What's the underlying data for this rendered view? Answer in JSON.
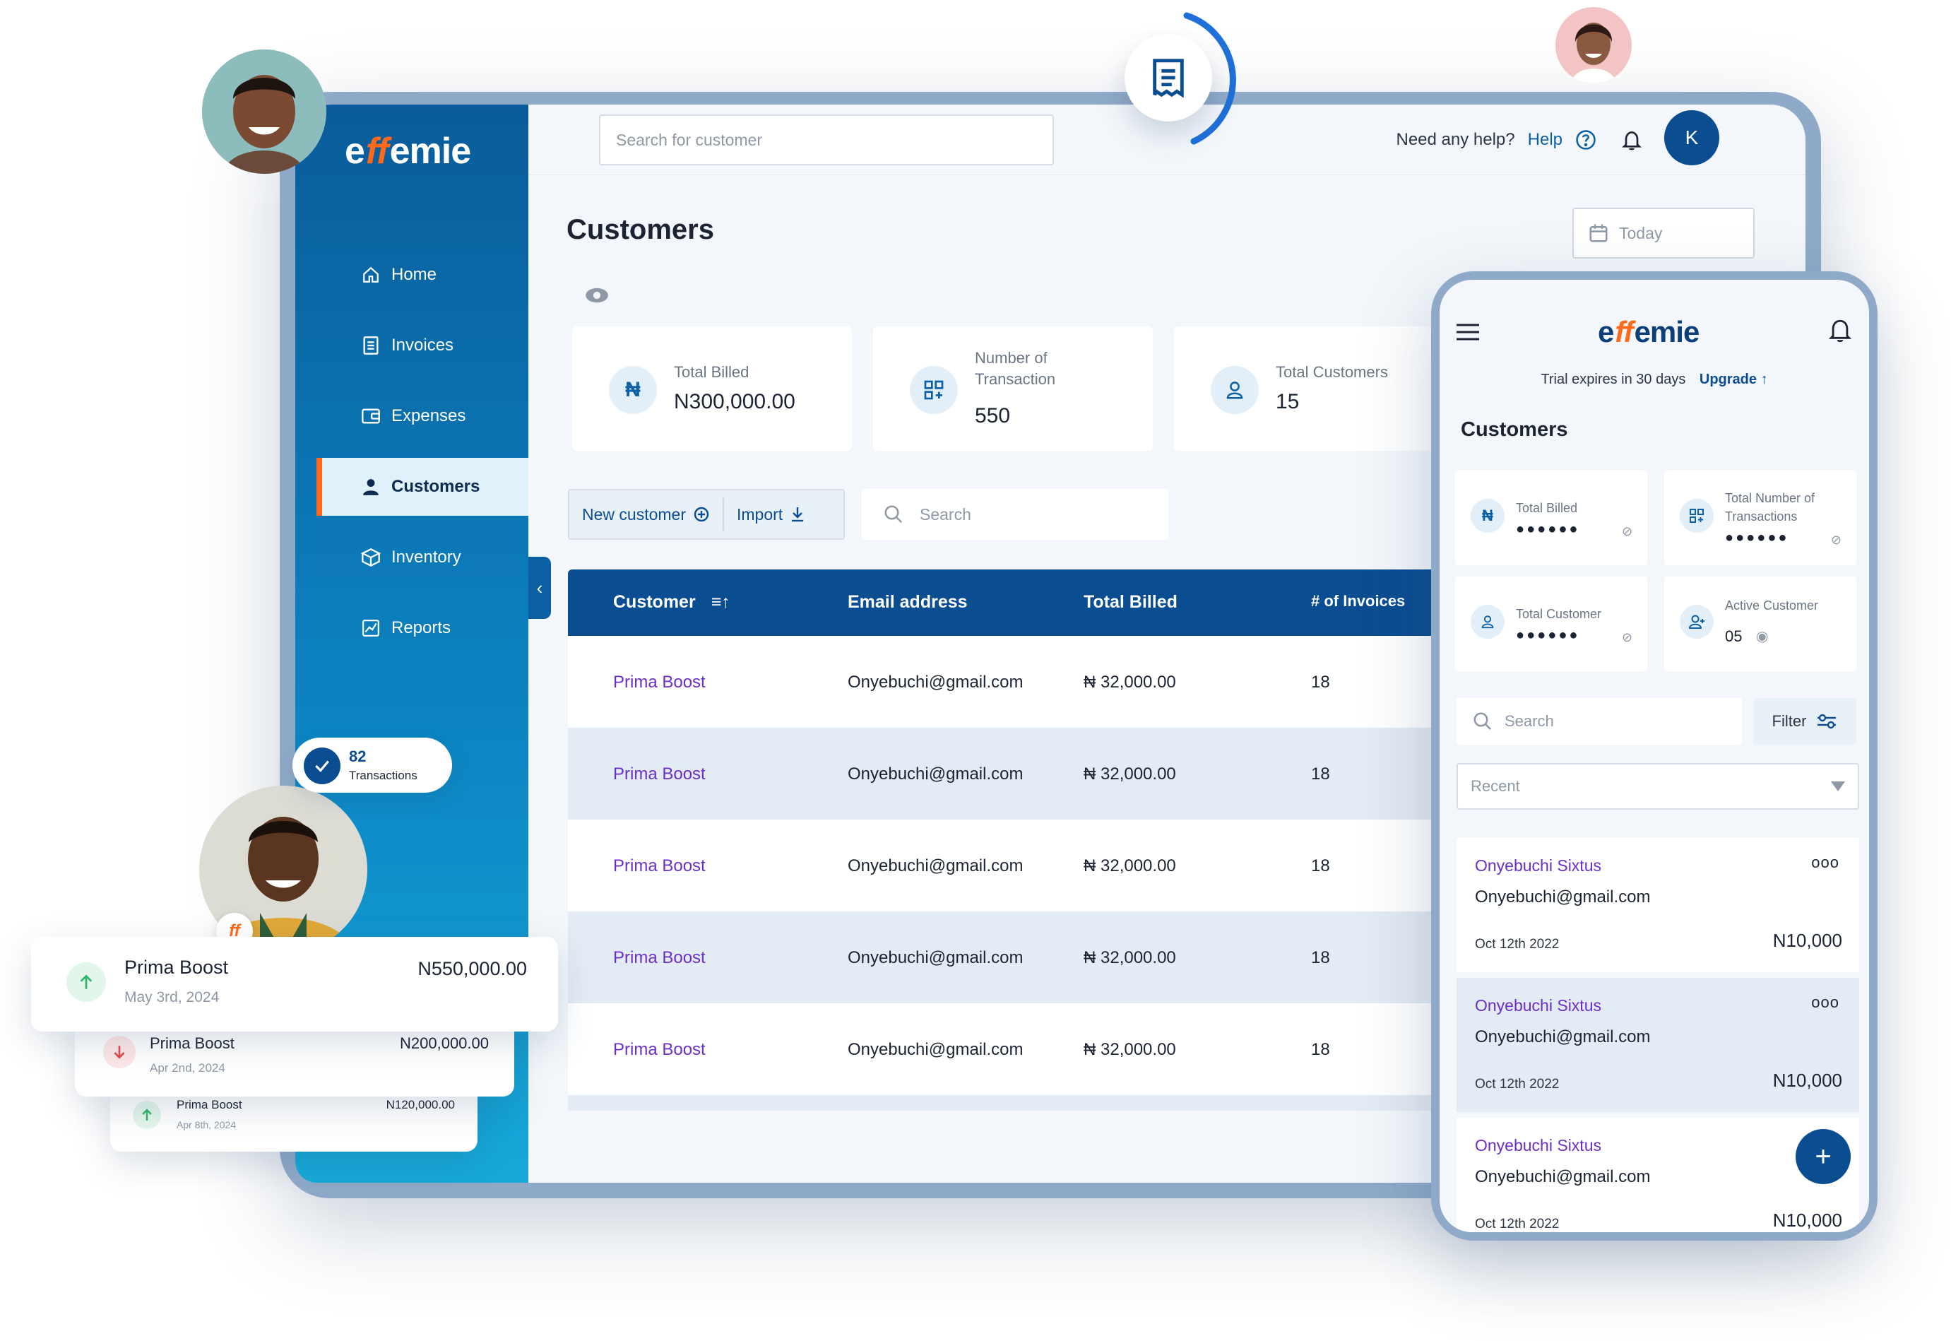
{
  "brand": {
    "logo_pre": "e",
    "logo_ff": "ff",
    "logo_post": "emie"
  },
  "sidebar": {
    "items": [
      {
        "label": "Home",
        "icon": "home-icon"
      },
      {
        "label": "Invoices",
        "icon": "invoice-icon"
      },
      {
        "label": "Expenses",
        "icon": "wallet-icon"
      },
      {
        "label": "Customers",
        "icon": "user-icon",
        "active": true
      },
      {
        "label": "Inventory",
        "icon": "box-icon"
      },
      {
        "label": "Reports",
        "icon": "chart-icon"
      }
    ]
  },
  "topbar": {
    "search_placeholder": "Search for customer",
    "help_prompt": "Need any help?",
    "help_link": "Help",
    "avatar_initial": "K"
  },
  "page": {
    "title": "Customers",
    "date_filter": "Today",
    "stats": [
      {
        "label": "Total Billed",
        "value": "N300,000.00",
        "icon_glyph": "₦"
      },
      {
        "label_line1": "Number of",
        "label_line2": "Transaction",
        "value": "550"
      },
      {
        "label": "Total Customers",
        "value": "15"
      }
    ],
    "actions": {
      "new_customer": "New customer",
      "import": "Import",
      "search_placeholder": "Search"
    }
  },
  "table": {
    "headers": {
      "customer": "Customer",
      "email": "Email address",
      "billed": "Total Billed",
      "invoices": "# of Invoices"
    },
    "rows": [
      {
        "name": "Prima Boost",
        "email": "Onyebuchi@gmail.com",
        "billed": "₦ 32,000.00",
        "invoices": "18"
      },
      {
        "name": "Prima Boost",
        "email": "Onyebuchi@gmail.com",
        "billed": "₦ 32,000.00",
        "invoices": "18"
      },
      {
        "name": "Prima Boost",
        "email": "Onyebuchi@gmail.com",
        "billed": "₦ 32,000.00",
        "invoices": "18"
      },
      {
        "name": "Prima Boost",
        "email": "Onyebuchi@gmail.com",
        "billed": "₦ 32,000.00",
        "invoices": "18"
      },
      {
        "name": "Prima Boost",
        "email": "Onyebuchi@gmail.com",
        "billed": "₦ 32,000.00",
        "invoices": "18"
      }
    ]
  },
  "mobile": {
    "trial_text": "Trial expires in 30 days",
    "upgrade": "Upgrade",
    "title": "Customers",
    "cards": [
      {
        "label": "Total Billed",
        "masked": "●●●●●●",
        "icon_glyph": "₦"
      },
      {
        "label_line1": "Total Number of",
        "label_line2": "Transactions",
        "masked": "●●●●●●"
      },
      {
        "label": "Total Customer",
        "masked": "●●●●●●"
      },
      {
        "label": "Active Customer",
        "value": "05"
      }
    ],
    "search_placeholder": "Search",
    "filter": "Filter",
    "sort_placeholder": "Recent",
    "items": [
      {
        "name": "Onyebuchi Sixtus",
        "email": "Onyebuchi@gmail.com",
        "date": "Oct 12th 2022",
        "amount": "N10,000",
        "more": "ooo"
      },
      {
        "name": "Onyebuchi Sixtus",
        "email": "Onyebuchi@gmail.com",
        "date": "Oct 12th 2022",
        "amount": "N10,000",
        "more": "ooo"
      },
      {
        "name": "Onyebuchi Sixtus",
        "email": "Onyebuchi@gmail.com",
        "date": "Oct 12th 2022",
        "amount": "N10,000"
      }
    ],
    "fab": "+"
  },
  "floating": {
    "transactions_count": "82",
    "transactions_label": "Transactions",
    "cards": [
      {
        "name": "Prima Boost",
        "date": "May 3rd, 2024",
        "amount": "N550,000.00",
        "direction": "up"
      },
      {
        "name": "Prima Boost",
        "date": "Apr 2nd, 2024",
        "amount": "N200,000.00",
        "direction": "down"
      },
      {
        "name": "Prima Boost",
        "date": "Apr 8th, 2024",
        "amount": "N120,000.00",
        "direction": "up"
      }
    ]
  },
  "colors": {
    "primary": "#0b4d91",
    "accent": "#ff6a1a",
    "sidebar": "#0c86c4",
    "link_purple": "#6a2fc9"
  }
}
